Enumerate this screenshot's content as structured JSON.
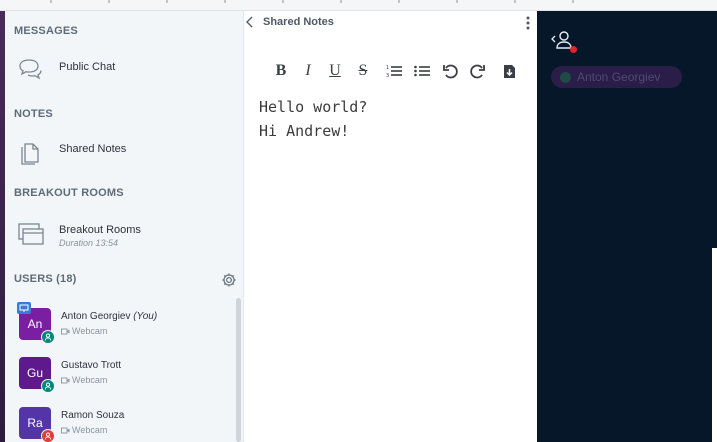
{
  "sidebar": {
    "messages_title": "MESSAGES",
    "public_chat": "Public Chat",
    "notes_title": "NOTES",
    "shared_notes": "Shared Notes",
    "breakout_title": "BREAKOUT ROOMS",
    "breakout_label": "Breakout Rooms",
    "breakout_duration": "Duration 13:54",
    "users_title": "USERS (18)"
  },
  "users": [
    {
      "initials": "An",
      "name": "Anton Georgiev",
      "you": "(You)",
      "media": "Webcam",
      "avatar_color": "#7b1fa2",
      "badge_color": "#00897b"
    },
    {
      "initials": "Gu",
      "name": "Gustavo Trott",
      "you": "",
      "media": "Webcam",
      "avatar_color": "#5e1a8c",
      "badge_color": "#00897b"
    },
    {
      "initials": "Ra",
      "name": "Ramon Souza",
      "you": "",
      "media": "Webcam",
      "avatar_color": "#5335a8",
      "badge_color": "#e53935"
    }
  ],
  "notes": {
    "title": "Shared Notes",
    "lines": [
      "Hello world?",
      "Hi Andrew!"
    ],
    "toolbar": [
      "bold-icon",
      "italic-icon",
      "underline-icon",
      "strikethrough-icon",
      "ordered-list-icon",
      "bullet-list-icon",
      "undo-icon",
      "redo-icon",
      "import-icon"
    ]
  },
  "right_panel": {
    "presenter_name": "Anton Georgiev"
  }
}
